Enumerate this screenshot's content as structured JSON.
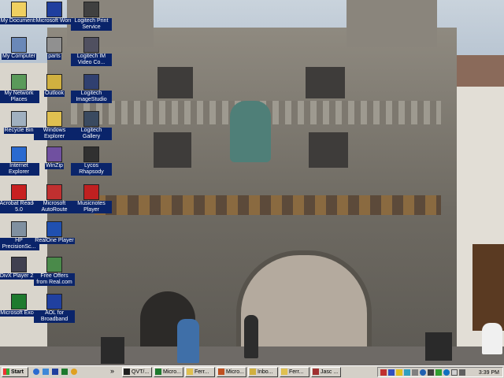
{
  "desktop_icons": [
    {
      "label": "My Documents",
      "icon": "folder-icon"
    },
    {
      "label": "My Computer",
      "icon": "computer-icon"
    },
    {
      "label": "My Network Places",
      "icon": "network-icon"
    },
    {
      "label": "Recycle Bin",
      "icon": "recycle-bin-icon"
    },
    {
      "label": "Internet Explorer",
      "icon": "internet-explorer-icon"
    },
    {
      "label": "Acrobat Reader 5.0",
      "icon": "acrobat-icon"
    },
    {
      "label": "HP PrecisionSc...",
      "icon": "scanner-icon"
    },
    {
      "label": "DivX Player 2.1",
      "icon": "divx-icon"
    },
    {
      "label": "Microsoft Excel",
      "icon": "excel-icon"
    },
    {
      "label": "Microsoft Word",
      "icon": "word-icon"
    },
    {
      "label": "parts",
      "icon": "shortcut-icon"
    },
    {
      "label": "Outlook",
      "icon": "outlook-icon"
    },
    {
      "label": "Windows Explorer",
      "icon": "explorer-icon"
    },
    {
      "label": "WinZip",
      "icon": "winzip-icon"
    },
    {
      "label": "Microsoft AutoRoute",
      "icon": "autoroute-icon"
    },
    {
      "label": "RealOne Player",
      "icon": "realone-icon"
    },
    {
      "label": "Free Offers from Real.com",
      "icon": "real-offers-icon"
    },
    {
      "label": "AOL for Broadband",
      "icon": "aol-icon"
    },
    {
      "label": "Logitech Print Service",
      "icon": "logitech-icon"
    },
    {
      "label": "Logitech IM Video Co...",
      "icon": "logitech-video-icon"
    },
    {
      "label": "Logitech ImageStudio",
      "icon": "logitech-imagestudio-icon"
    },
    {
      "label": "Logitech Gallery",
      "icon": "logitech-gallery-icon"
    },
    {
      "label": "Lycos Rhapsody",
      "icon": "rhapsody-icon"
    },
    {
      "label": "Musicnotes Player",
      "icon": "musicnotes-icon"
    }
  ],
  "taskbar": {
    "start_label": "Start",
    "quick_launch": [
      "ie-icon",
      "outlook-express-icon",
      "word-icon",
      "excel-icon",
      "media-icon"
    ],
    "overflow_label": "»",
    "windows": [
      {
        "label": "QVT/...",
        "icon": "terminal-icon"
      },
      {
        "label": "Micro...",
        "icon": "excel-icon"
      },
      {
        "label": "Ferr...",
        "icon": "explorer-icon"
      },
      {
        "label": "Micro...",
        "icon": "powerpoint-icon"
      },
      {
        "label": "Inbo...",
        "icon": "outlook-icon"
      },
      {
        "label": "Ferr...",
        "icon": "explorer-icon"
      },
      {
        "label": "Jasc ...",
        "icon": "paint-shop-icon"
      }
    ],
    "clock": "3:39 PM"
  }
}
